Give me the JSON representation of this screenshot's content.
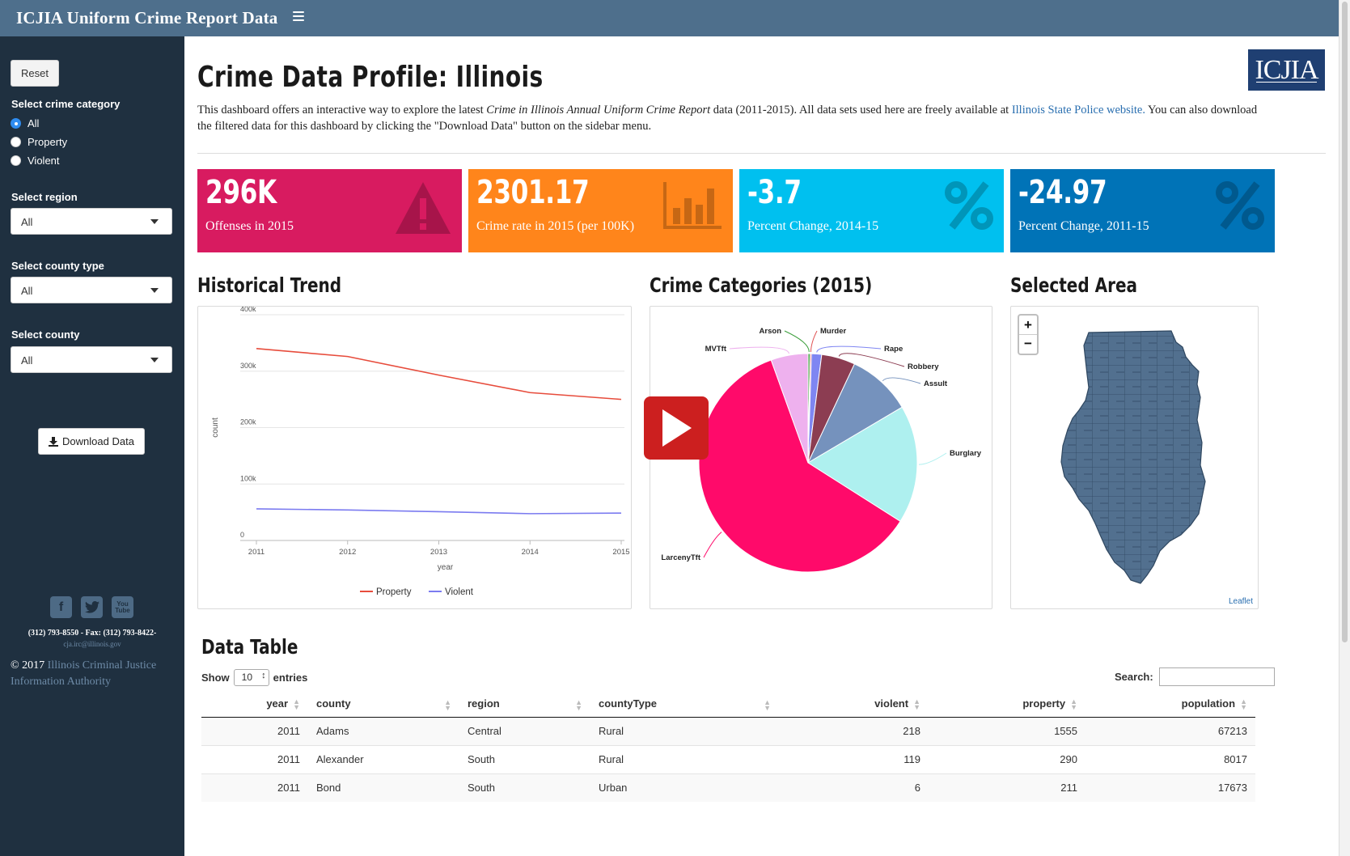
{
  "app": {
    "title": "ICJIA Uniform Crime Report Data"
  },
  "sidebar": {
    "reset_label": "Reset",
    "crime_category_label": "Select crime category",
    "crime_categories": [
      {
        "label": "All",
        "selected": true
      },
      {
        "label": "Property",
        "selected": false
      },
      {
        "label": "Violent",
        "selected": false
      }
    ],
    "region_label": "Select region",
    "region_value": "All",
    "county_type_label": "Select county type",
    "county_type_value": "All",
    "county_label": "Select county",
    "county_value": "All",
    "download_label": "Download Data",
    "social_icons": [
      "facebook-icon",
      "twitter-icon",
      "youtube-icon"
    ],
    "youtube_text": "You Tube",
    "phone": "(312) 793-8550 - Fax: (312) 793-8422-",
    "email": "cja.irc@illinois.gov",
    "copyright_year": "© 2017",
    "copyright_org": "Illinois Criminal Justice Information Authority"
  },
  "page": {
    "title": "Crime Data Profile: Illinois",
    "logo_text": "ICJIA",
    "intro": {
      "part1": "This dashboard offers an interactive way to explore the latest ",
      "italic": "Crime in Illinois Annual Uniform Crime Report",
      "part2": " data (2011-2015). All data sets used here are freely available at ",
      "link": "Illinois State Police website.",
      "part3": " You can also download the filtered data for this dashboard by clicking the \"Download Data\" button on the sidebar menu."
    }
  },
  "value_boxes": [
    {
      "value": "296K",
      "label": "Offenses in 2015",
      "color": "#d81b60",
      "icon": "warning-icon"
    },
    {
      "value": "2301.17",
      "label": "Crime rate in 2015 (per 100K)",
      "color": "#ff851b",
      "icon": "bar-chart-icon"
    },
    {
      "value": "-3.7",
      "label": "Percent Change, 2014-15",
      "color": "#00c0ef",
      "icon": "percent-icon"
    },
    {
      "value": "-24.97",
      "label": "Percent Change, 2011-15",
      "color": "#0073b7",
      "icon": "percent-icon"
    }
  ],
  "sections": {
    "trend": "Historical Trend",
    "categories": "Crime Categories (2015)",
    "area": "Selected Area",
    "table": "Data Table"
  },
  "chart_data": [
    {
      "type": "line",
      "x": [
        2011,
        2012,
        2013,
        2014,
        2015
      ],
      "xlabel": "year",
      "ylabel": "count",
      "ylim": [
        0,
        400000
      ],
      "yticks": [
        "0",
        "100k",
        "200k",
        "300k",
        "400k"
      ],
      "series": [
        {
          "name": "Property",
          "color": "#e74c3c",
          "values": [
            340000,
            326000,
            293000,
            262000,
            250000
          ]
        },
        {
          "name": "Violent",
          "color": "#7b7bf0",
          "values": [
            56000,
            54000,
            51000,
            47500,
            48500
          ]
        }
      ],
      "legend": "bottom"
    },
    {
      "type": "pie",
      "title": "",
      "slices": [
        {
          "label": "Arson",
          "value": 0.3,
          "color": "#3a9d3a"
        },
        {
          "label": "Murder",
          "value": 0.2,
          "color": "#e05555"
        },
        {
          "label": "Rape",
          "value": 1.5,
          "color": "#7f86f2"
        },
        {
          "label": "Robbery",
          "value": 5.0,
          "color": "#8c3d52"
        },
        {
          "label": "Assult",
          "value": 9.5,
          "color": "#7592bd"
        },
        {
          "label": "Burglary",
          "value": 17.5,
          "color": "#aef0ef"
        },
        {
          "label": "LarcenyTft",
          "value": 60.5,
          "color": "#ff0a6a"
        },
        {
          "label": "MVTft",
          "value": 5.5,
          "color": "#eeb1ee"
        }
      ]
    }
  ],
  "map": {
    "attribution": "Leaflet",
    "zoom_in": "+",
    "zoom_out": "−"
  },
  "table": {
    "show_label": "Show",
    "page_length": "10",
    "entries_label": "entries",
    "search_label": "Search:",
    "columns": [
      "year",
      "county",
      "region",
      "countyType",
      "violent",
      "property",
      "population"
    ],
    "rows": [
      [
        "2011",
        "Adams",
        "Central",
        "Rural",
        "218",
        "1555",
        "67213"
      ],
      [
        "2011",
        "Alexander",
        "South",
        "Rural",
        "119",
        "290",
        "8017"
      ],
      [
        "2011",
        "Bond",
        "South",
        "Urban",
        "6",
        "211",
        "17673"
      ]
    ]
  }
}
